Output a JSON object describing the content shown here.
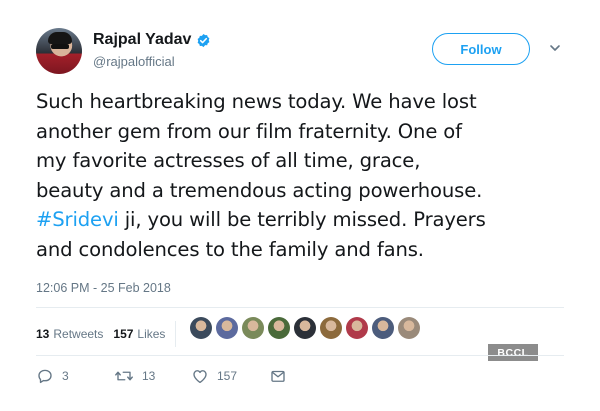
{
  "author": {
    "name": "Rajpal Yadav",
    "handle": "@rajpalofficial",
    "verified_icon": "verified-badge-icon"
  },
  "header": {
    "follow_label": "Follow",
    "menu_icon": "chevron-down-icon"
  },
  "tweet": {
    "lines": [
      "Such heartbreaking news today. We have lost",
      "another gem from our film fraternity. One of",
      "my favorite actresses of all time, grace,",
      "beauty and a tremendous acting powerhouse."
    ],
    "hashtag": "#Sridevi",
    "line5_rest": " ji, you will be terribly missed. Prayers",
    "line6": "and condolences to the family and fans."
  },
  "timestamp": "12:06 PM - 25 Feb 2018",
  "stats": {
    "retweets_count": "13",
    "retweets_label": "Retweets",
    "likes_count": "157",
    "likes_label": "Likes"
  },
  "liker_avatars": [
    "#3b4a5c",
    "#5c6a9e",
    "#7a8a5a",
    "#4a6a3a",
    "#2b3038",
    "#8c6a3c",
    "#b03a4a",
    "#4c5c7c",
    "#9a8a7a"
  ],
  "actions": {
    "reply_count": "3",
    "retweet_count": "13",
    "like_count": "157"
  },
  "watermark": "BCCL",
  "colors": {
    "accent": "#1da1f2",
    "text": "#14171a",
    "muted": "#657786",
    "divider": "#e6ecf0"
  }
}
